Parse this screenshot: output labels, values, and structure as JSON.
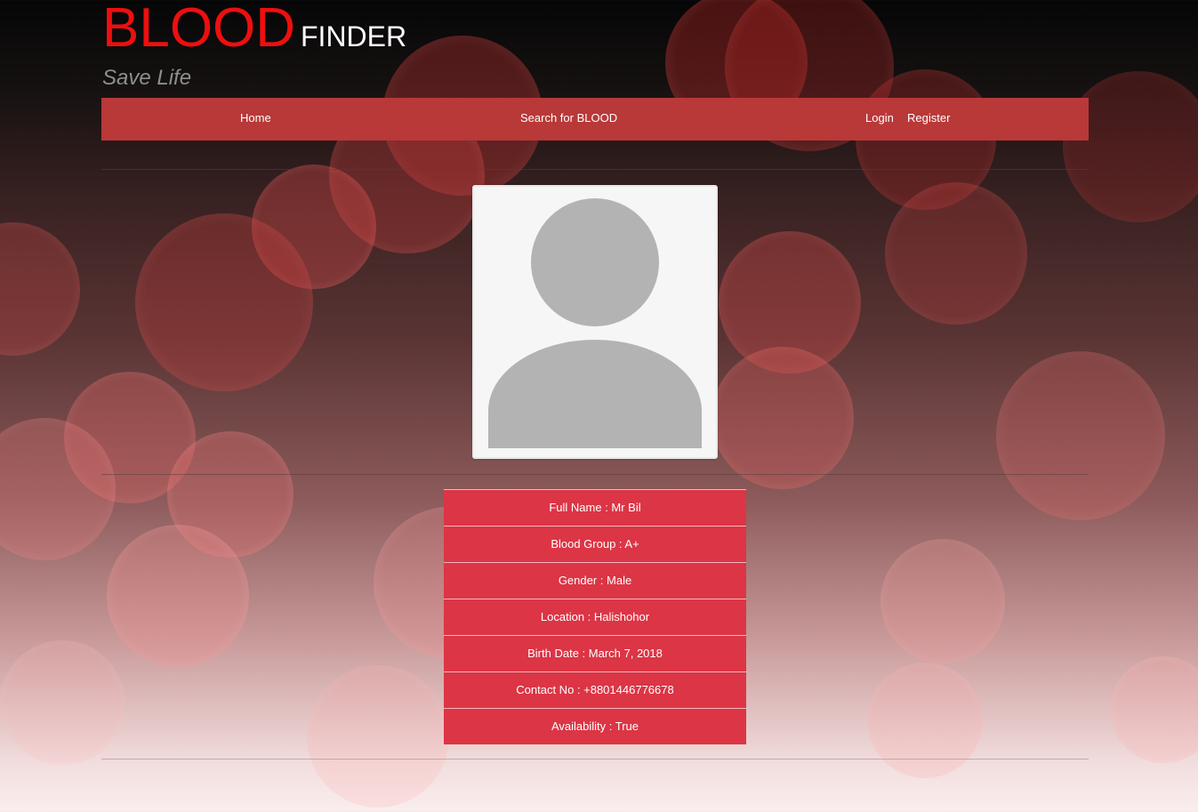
{
  "header": {
    "brand_big": "BLOOD",
    "brand_small": "FINDER",
    "tagline": "Save Life"
  },
  "nav": {
    "home": "Home",
    "search": "Search for BLOOD",
    "login": "Login",
    "register": "Register"
  },
  "profile": {
    "avatar_icon": "user-placeholder-icon",
    "fields": [
      "Full Name : Mr Bil",
      "Blood Group : A+",
      "Gender : Male",
      "Location : Halishohor",
      "Birth Date : March 7, 2018",
      "Contact No : +8801446776678",
      "Availability : True"
    ]
  },
  "colors": {
    "brand_red": "#ee0f0f",
    "nav_bg": "#b93838",
    "info_row_bg": "#dc3545"
  }
}
